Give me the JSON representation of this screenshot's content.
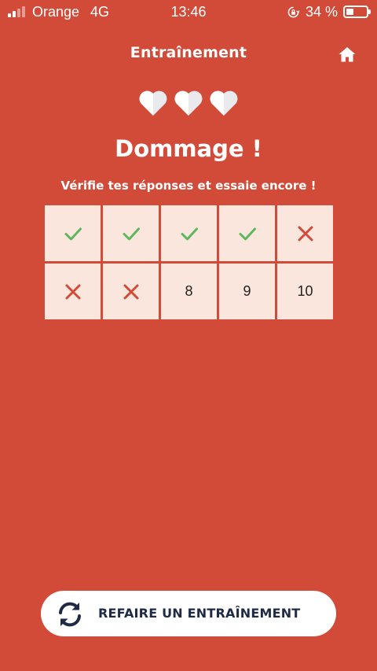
{
  "status_bar": {
    "carrier": "Orange",
    "network": "4G",
    "time": "13:46",
    "battery_percent": "34 %",
    "battery_level": 0.34,
    "signal_bars_active": 2,
    "icons": [
      "signal-icon",
      "orientation-lock-icon",
      "battery-icon"
    ]
  },
  "header": {
    "title": "Entraînement",
    "home_icon": "home-icon"
  },
  "lives": {
    "count": 3,
    "icon": "heart-icon",
    "color": "#e9e9ee"
  },
  "result": {
    "title": "Dommage !",
    "subtitle": "Vérifie tes réponses et essaie encore !"
  },
  "answers": [
    {
      "type": "correct",
      "icon": "check-icon"
    },
    {
      "type": "correct",
      "icon": "check-icon"
    },
    {
      "type": "correct",
      "icon": "check-icon"
    },
    {
      "type": "correct",
      "icon": "check-icon"
    },
    {
      "type": "wrong",
      "icon": "cross-icon"
    },
    {
      "type": "wrong",
      "icon": "cross-icon"
    },
    {
      "type": "wrong",
      "icon": "cross-icon"
    },
    {
      "type": "number",
      "label": "8"
    },
    {
      "type": "number",
      "label": "9"
    },
    {
      "type": "number",
      "label": "10"
    }
  ],
  "retry_button": {
    "label": "REFAIRE UN ENTRAÎNEMENT",
    "icon": "refresh-icon"
  },
  "colors": {
    "background": "#d24b39",
    "cell": "#fbe6dd",
    "check": "#5cb85c",
    "cross": "#d24b39",
    "button_text": "#1f2a44"
  }
}
